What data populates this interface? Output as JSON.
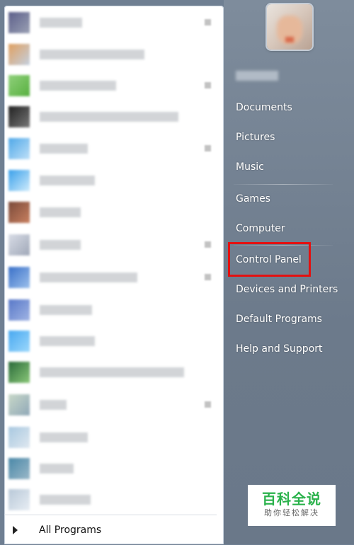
{
  "start_menu": {
    "right_links": [
      {
        "label": "Documents"
      },
      {
        "label": "Pictures"
      },
      {
        "label": "Music"
      },
      {
        "label": "Games"
      },
      {
        "label": "Computer"
      },
      {
        "label": "Control Panel"
      },
      {
        "label": "Devices and Printers"
      },
      {
        "label": "Default Programs"
      },
      {
        "label": "Help and Support"
      }
    ],
    "all_programs_label": "All Programs",
    "highlighted_item": "Control Panel",
    "highlight_color": "#e41010"
  },
  "watermark": {
    "title": "百科全说",
    "subtitle": "助你轻松解决",
    "title_color": "#2bb24c"
  }
}
